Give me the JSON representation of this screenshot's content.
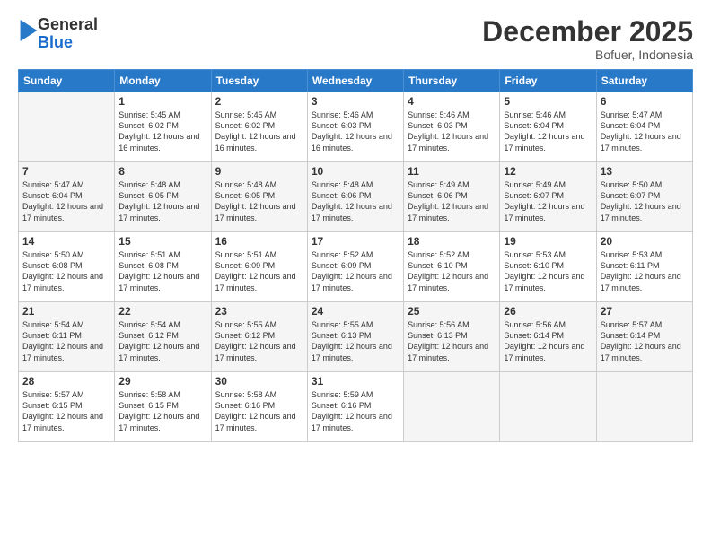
{
  "header": {
    "logo": {
      "line1": "General",
      "line2": "Blue"
    },
    "title": "December 2025",
    "location": "Bofuer, Indonesia"
  },
  "weekdays": [
    "Sunday",
    "Monday",
    "Tuesday",
    "Wednesday",
    "Thursday",
    "Friday",
    "Saturday"
  ],
  "weeks": [
    [
      {
        "day": "",
        "empty": true
      },
      {
        "day": "1",
        "sunrise": "5:45 AM",
        "sunset": "6:02 PM",
        "daylight": "12 hours and 16 minutes."
      },
      {
        "day": "2",
        "sunrise": "5:45 AM",
        "sunset": "6:02 PM",
        "daylight": "12 hours and 16 minutes."
      },
      {
        "day": "3",
        "sunrise": "5:46 AM",
        "sunset": "6:03 PM",
        "daylight": "12 hours and 16 minutes."
      },
      {
        "day": "4",
        "sunrise": "5:46 AM",
        "sunset": "6:03 PM",
        "daylight": "12 hours and 17 minutes."
      },
      {
        "day": "5",
        "sunrise": "5:46 AM",
        "sunset": "6:04 PM",
        "daylight": "12 hours and 17 minutes."
      },
      {
        "day": "6",
        "sunrise": "5:47 AM",
        "sunset": "6:04 PM",
        "daylight": "12 hours and 17 minutes."
      }
    ],
    [
      {
        "day": "7",
        "sunrise": "5:47 AM",
        "sunset": "6:04 PM",
        "daylight": "12 hours and 17 minutes."
      },
      {
        "day": "8",
        "sunrise": "5:48 AM",
        "sunset": "6:05 PM",
        "daylight": "12 hours and 17 minutes."
      },
      {
        "day": "9",
        "sunrise": "5:48 AM",
        "sunset": "6:05 PM",
        "daylight": "12 hours and 17 minutes."
      },
      {
        "day": "10",
        "sunrise": "5:48 AM",
        "sunset": "6:06 PM",
        "daylight": "12 hours and 17 minutes."
      },
      {
        "day": "11",
        "sunrise": "5:49 AM",
        "sunset": "6:06 PM",
        "daylight": "12 hours and 17 minutes."
      },
      {
        "day": "12",
        "sunrise": "5:49 AM",
        "sunset": "6:07 PM",
        "daylight": "12 hours and 17 minutes."
      },
      {
        "day": "13",
        "sunrise": "5:50 AM",
        "sunset": "6:07 PM",
        "daylight": "12 hours and 17 minutes."
      }
    ],
    [
      {
        "day": "14",
        "sunrise": "5:50 AM",
        "sunset": "6:08 PM",
        "daylight": "12 hours and 17 minutes."
      },
      {
        "day": "15",
        "sunrise": "5:51 AM",
        "sunset": "6:08 PM",
        "daylight": "12 hours and 17 minutes."
      },
      {
        "day": "16",
        "sunrise": "5:51 AM",
        "sunset": "6:09 PM",
        "daylight": "12 hours and 17 minutes."
      },
      {
        "day": "17",
        "sunrise": "5:52 AM",
        "sunset": "6:09 PM",
        "daylight": "12 hours and 17 minutes."
      },
      {
        "day": "18",
        "sunrise": "5:52 AM",
        "sunset": "6:10 PM",
        "daylight": "12 hours and 17 minutes."
      },
      {
        "day": "19",
        "sunrise": "5:53 AM",
        "sunset": "6:10 PM",
        "daylight": "12 hours and 17 minutes."
      },
      {
        "day": "20",
        "sunrise": "5:53 AM",
        "sunset": "6:11 PM",
        "daylight": "12 hours and 17 minutes."
      }
    ],
    [
      {
        "day": "21",
        "sunrise": "5:54 AM",
        "sunset": "6:11 PM",
        "daylight": "12 hours and 17 minutes."
      },
      {
        "day": "22",
        "sunrise": "5:54 AM",
        "sunset": "6:12 PM",
        "daylight": "12 hours and 17 minutes."
      },
      {
        "day": "23",
        "sunrise": "5:55 AM",
        "sunset": "6:12 PM",
        "daylight": "12 hours and 17 minutes."
      },
      {
        "day": "24",
        "sunrise": "5:55 AM",
        "sunset": "6:13 PM",
        "daylight": "12 hours and 17 minutes."
      },
      {
        "day": "25",
        "sunrise": "5:56 AM",
        "sunset": "6:13 PM",
        "daylight": "12 hours and 17 minutes."
      },
      {
        "day": "26",
        "sunrise": "5:56 AM",
        "sunset": "6:14 PM",
        "daylight": "12 hours and 17 minutes."
      },
      {
        "day": "27",
        "sunrise": "5:57 AM",
        "sunset": "6:14 PM",
        "daylight": "12 hours and 17 minutes."
      }
    ],
    [
      {
        "day": "28",
        "sunrise": "5:57 AM",
        "sunset": "6:15 PM",
        "daylight": "12 hours and 17 minutes."
      },
      {
        "day": "29",
        "sunrise": "5:58 AM",
        "sunset": "6:15 PM",
        "daylight": "12 hours and 17 minutes."
      },
      {
        "day": "30",
        "sunrise": "5:58 AM",
        "sunset": "6:16 PM",
        "daylight": "12 hours and 17 minutes."
      },
      {
        "day": "31",
        "sunrise": "5:59 AM",
        "sunset": "6:16 PM",
        "daylight": "12 hours and 17 minutes."
      },
      {
        "day": "",
        "empty": true
      },
      {
        "day": "",
        "empty": true
      },
      {
        "day": "",
        "empty": true
      }
    ]
  ],
  "labels": {
    "sunrise_prefix": "Sunrise: ",
    "sunset_prefix": "Sunset: ",
    "daylight_prefix": "Daylight: "
  }
}
